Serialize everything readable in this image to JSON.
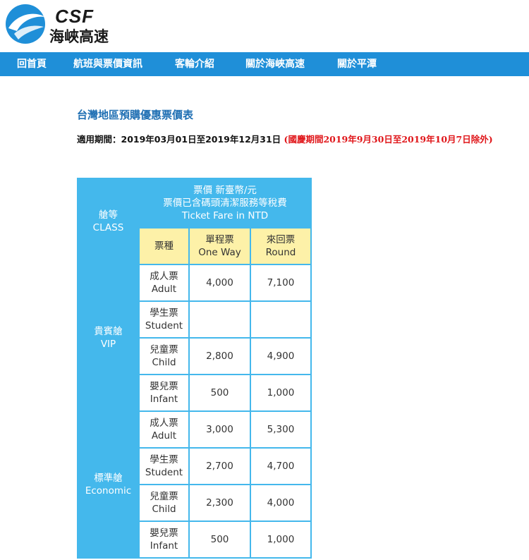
{
  "header": {
    "logo_brand": "CSF",
    "logo_name": "海峽高速"
  },
  "nav": {
    "items": [
      {
        "label": "回首頁"
      },
      {
        "label": "航班與票價資訊"
      },
      {
        "label": "客輪介紹"
      },
      {
        "label": "關於海峽高速"
      },
      {
        "label": "關於平潭"
      }
    ]
  },
  "colors": {
    "nav_bg": "#1f8fd8",
    "table_blue": "#44b8ec",
    "header_yellow": "#fdf1a8",
    "title_blue": "#1f6fb3",
    "exception_red": "#e0161a"
  },
  "page": {
    "title": "台灣地區預購優惠票價表",
    "period_label": "適用期間：2019年03月01日至2019年12月31日",
    "period_exception": "(國慶期間2019年9月30日至2019年10月7日除外)"
  },
  "table": {
    "class_header_zh": "艙等",
    "class_header_en": "CLASS",
    "fare_header_line1": "票價 新臺幣/元",
    "fare_header_line2": "票價已含碼頭清潔服務等稅費",
    "fare_header_line3": "Ticket Fare in NTD",
    "ticket_type_header": "票種",
    "oneway_header_zh": "單程票",
    "oneway_header_en": "One Way",
    "round_header_zh": "來回票",
    "round_header_en": "Round",
    "classes": [
      {
        "name_zh": "貴賓艙",
        "name_en": "VIP",
        "rows": [
          {
            "type_zh": "成人票",
            "type_en": "Adult",
            "oneway": "4,000",
            "round": "7,100"
          },
          {
            "type_zh": "學生票",
            "type_en": "Student",
            "oneway": "",
            "round": ""
          },
          {
            "type_zh": "兒童票",
            "type_en": "Child",
            "oneway": "2,800",
            "round": "4,900"
          },
          {
            "type_zh": "嬰兒票",
            "type_en": "Infant",
            "oneway": "500",
            "round": "1,000"
          }
        ]
      },
      {
        "name_zh": "標準艙",
        "name_en": "Economic",
        "rows": [
          {
            "type_zh": "成人票",
            "type_en": "Adult",
            "oneway": "3,000",
            "round": "5,300"
          },
          {
            "type_zh": "學生票",
            "type_en": "Student",
            "oneway": "2,700",
            "round": "4,700"
          },
          {
            "type_zh": "兒童票",
            "type_en": "Child",
            "oneway": "2,300",
            "round": "4,000"
          },
          {
            "type_zh": "嬰兒票",
            "type_en": "Infant",
            "oneway": "500",
            "round": "1,000"
          }
        ]
      }
    ]
  }
}
